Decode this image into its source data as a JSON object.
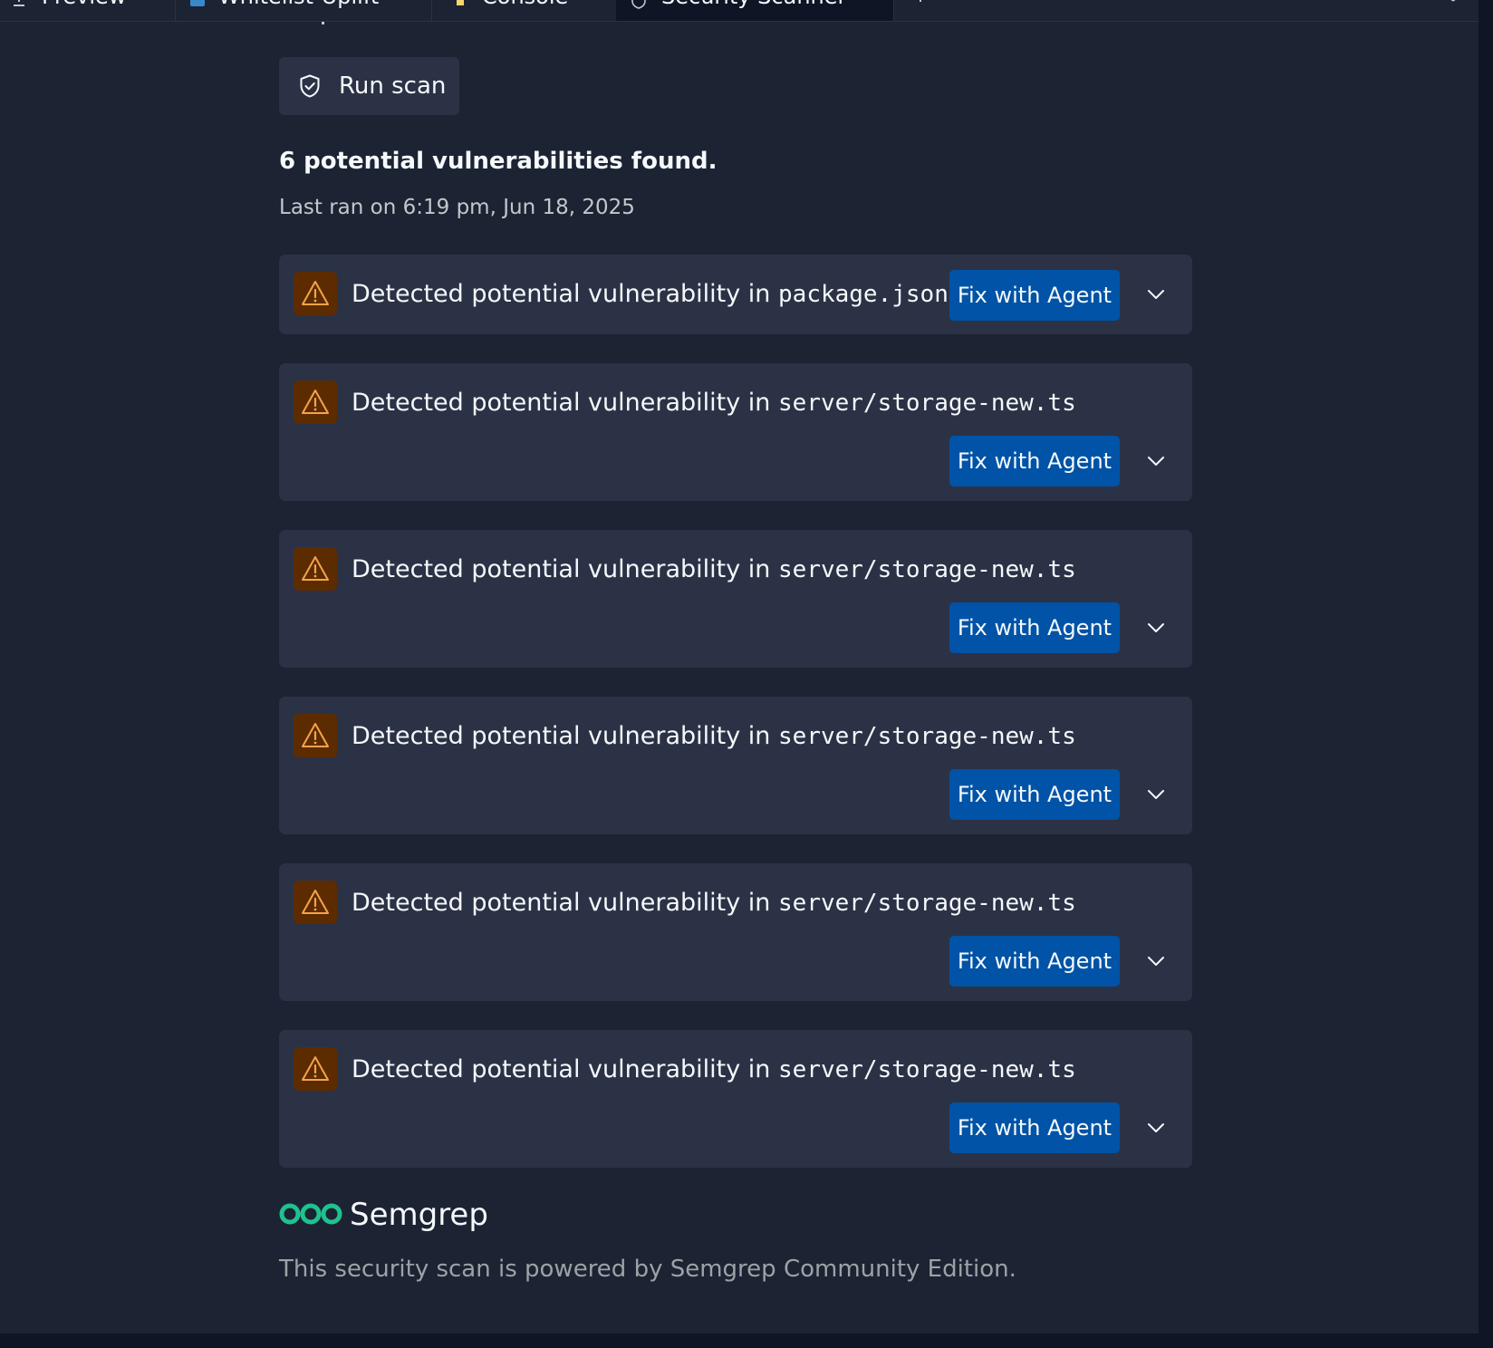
{
  "tabs": [
    {
      "label": "Preview",
      "icon": "upload-icon"
    },
    {
      "label": "Whitelist-Uplift",
      "icon": "app-icon"
    },
    {
      "label": "Console",
      "icon": "terminal-icon"
    },
    {
      "label": "Security Scanner",
      "icon": "shield-icon",
      "active": true
    }
  ],
  "toolbar": {
    "more_icon": "kebab-menu-icon"
  },
  "scan": {
    "run_label": "Run scan",
    "run_icon": "shield-check-icon",
    "summary": "6 potential vulnerabilities found.",
    "last_ran": "Last ran on 6:19 pm, Jun 18, 2025"
  },
  "findings": [
    {
      "prefix": "Detected potential vulnerability in",
      "file": "package.json",
      "action": "Fix with Agent"
    },
    {
      "prefix": "Detected potential vulnerability in",
      "file": "server/storage-new.ts",
      "action": "Fix with Agent"
    },
    {
      "prefix": "Detected potential vulnerability in",
      "file": "server/storage-new.ts",
      "action": "Fix with Agent"
    },
    {
      "prefix": "Detected potential vulnerability in",
      "file": "server/storage-new.ts",
      "action": "Fix with Agent"
    },
    {
      "prefix": "Detected potential vulnerability in",
      "file": "server/storage-new.ts",
      "action": "Fix with Agent"
    },
    {
      "prefix": "Detected potential vulnerability in",
      "file": "server/storage-new.ts",
      "action": "Fix with Agent"
    }
  ],
  "footer": {
    "brand": "Semgrep",
    "note": "This security scan is powered by Semgrep Community Edition."
  },
  "colors": {
    "background": "#1c2333",
    "card": "#2b3245",
    "primary_button": "#0053a6",
    "warning_badge": "#5c2c00",
    "warning_icon": "#f5a34b",
    "brand_green": "#1fc28e"
  }
}
